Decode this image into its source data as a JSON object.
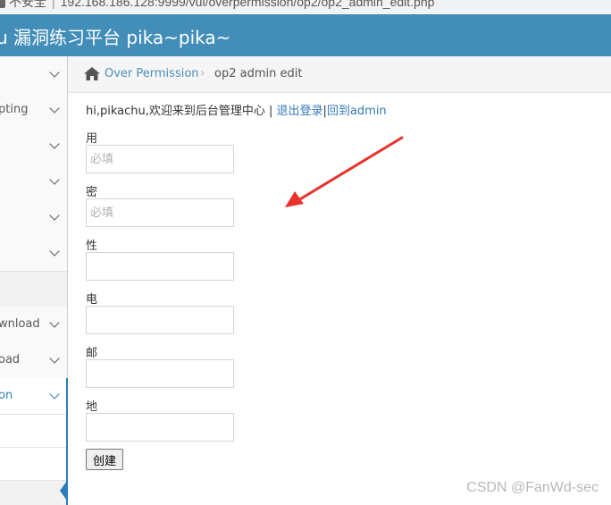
{
  "browser": {
    "security_label": "不安全",
    "url": "192.168.186.128:9999/vul/overpermission/op2/op2_admin_edit.php"
  },
  "header": {
    "brand": "u 漏洞练习平台 pika~pika~"
  },
  "sidebar": {
    "items": [
      {
        "label": ""
      },
      {
        "label": "pting"
      },
      {
        "label": ""
      },
      {
        "label": ""
      },
      {
        "label": ""
      },
      {
        "label": ""
      },
      {
        "label": "wnload"
      },
      {
        "label": "oad"
      },
      {
        "label": "on"
      }
    ]
  },
  "breadcrumb": {
    "home_link": "Over Permission",
    "current": "op2 admin edit"
  },
  "welcome": {
    "text": "hi,pikachu,欢迎来到后台管理中心 | ",
    "logout": "退出登录",
    "divider": "|",
    "back": "回到admin"
  },
  "form": {
    "fields": [
      {
        "label": "用户:",
        "placeholder": "必填",
        "value": ""
      },
      {
        "label": "密码:",
        "placeholder": "必填",
        "value": ""
      },
      {
        "label": "性别:",
        "placeholder": "",
        "value": ""
      },
      {
        "label": "电话:",
        "placeholder": "",
        "value": ""
      },
      {
        "label": "邮箱:",
        "placeholder": "",
        "value": ""
      },
      {
        "label": "地址:",
        "placeholder": "",
        "value": ""
      }
    ],
    "submit_label": "创建"
  },
  "watermark": "CSDN @FanWd-sec",
  "colors": {
    "navbar": "#438eb9",
    "link": "#337ab7",
    "annotation_arrow": "#e8322b"
  }
}
